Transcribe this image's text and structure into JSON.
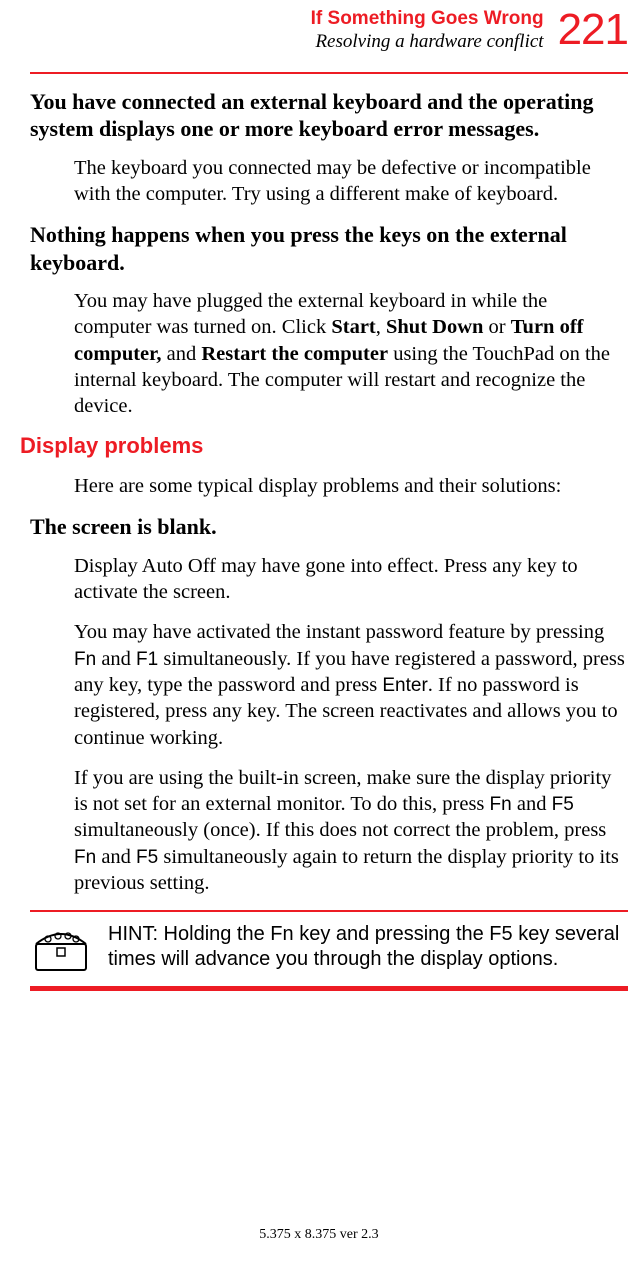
{
  "header": {
    "chapter": "If Something Goes Wrong",
    "section": "Resolving a hardware conflict",
    "page": "221"
  },
  "h1": "You have connected an external keyboard and the operating system displays one or more keyboard error messages.",
  "p1": "The keyboard you connected may be defective or incompatible with the computer. Try using a different make of keyboard.",
  "h2": "Nothing happens when you press the keys on the external keyboard.",
  "p2a": "You may have plugged the external keyboard in while the computer was turned on. Click ",
  "p2b_bold1": "Start",
  "p2b_sep1": ", ",
  "p2b_bold2": "Shut Down",
  "p2b_sep2": " or ",
  "p2b_bold3": "Turn off computer,",
  "p2b_sep3": " and ",
  "p2b_bold4": "Restart the computer",
  "p2c": " using the TouchPad on the internal keyboard. The computer will restart and recognize the device.",
  "red_heading": "Display problems",
  "p3": "Here are some typical display problems and their solutions:",
  "h3": "The screen is blank.",
  "p4": "Display Auto Off may have gone into effect. Press any key to activate the screen.",
  "p5a": "You may have activated the instant password feature by pressing ",
  "k_fn1": "Fn",
  "p5b": " and ",
  "k_f1": "F1",
  "p5c": " simultaneously. If you have registered a password, press any key, type the password and press ",
  "k_enter": "Enter",
  "p5d": ". If no password is registered, press any key. The screen reactivates and allows you to continue working.",
  "p6a": "If you are using the built-in screen, make sure the display priority is not set for an external monitor. To do this, press ",
  "k_fn2": "Fn",
  "p6b": " and ",
  "k_f5a": "F5",
  "p6c": " simultaneously (once). If this does not correct the problem, press ",
  "k_fn3": "Fn",
  "p6d": " and ",
  "k_f5b": "F5",
  "p6e": " simultaneously again to return the display priority to its previous setting.",
  "hint": "HINT: Holding the Fn key and pressing the F5 key several times will advance you through the display options.",
  "footer": "5.375 x 8.375 ver 2.3"
}
